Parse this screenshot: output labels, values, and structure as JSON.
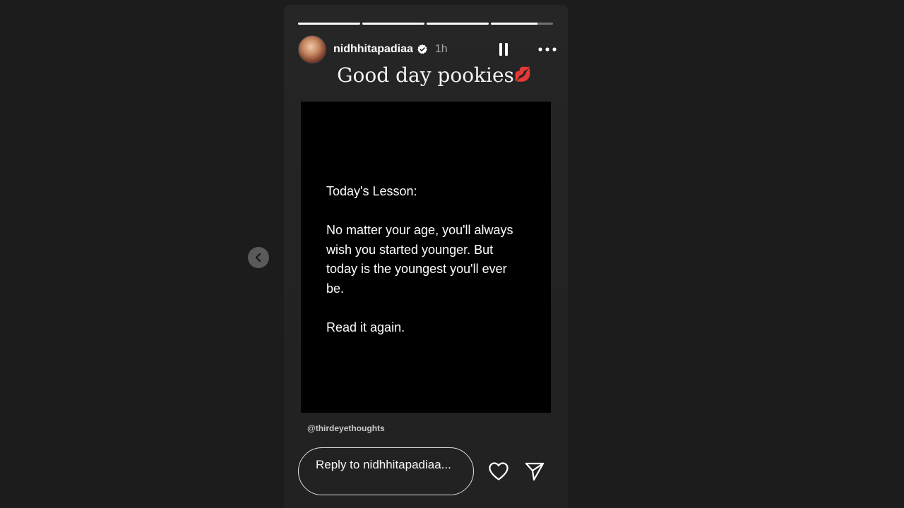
{
  "story": {
    "progress": [
      1.0,
      1.0,
      1.0,
      0.75
    ],
    "user": {
      "username": "nidhhitapadiaa",
      "verified": true,
      "time_ago": "1h"
    },
    "caption": {
      "text": "Good day pookies",
      "emoji": "💋"
    },
    "post": {
      "heading": "Today's Lesson:",
      "body": "No matter your age, you'll always wish you started younger. But today is the youngest you'll ever be.",
      "footer": "Read it again."
    },
    "mention": "@thirdeyethoughts",
    "reply": {
      "placeholder": "Reply to nidhhitapadiaa..."
    }
  },
  "icons": {
    "prev": "chevron-left-icon",
    "pause": "pause-icon",
    "more": "more-horizontal-icon",
    "like": "heart-icon",
    "share": "send-icon",
    "verified": "verified-badge-icon"
  },
  "colors": {
    "background": "#1c1c1c",
    "card": "#262626",
    "text": "#ffffff",
    "muted": "#a8a8a8",
    "verified": "#ffffff"
  }
}
